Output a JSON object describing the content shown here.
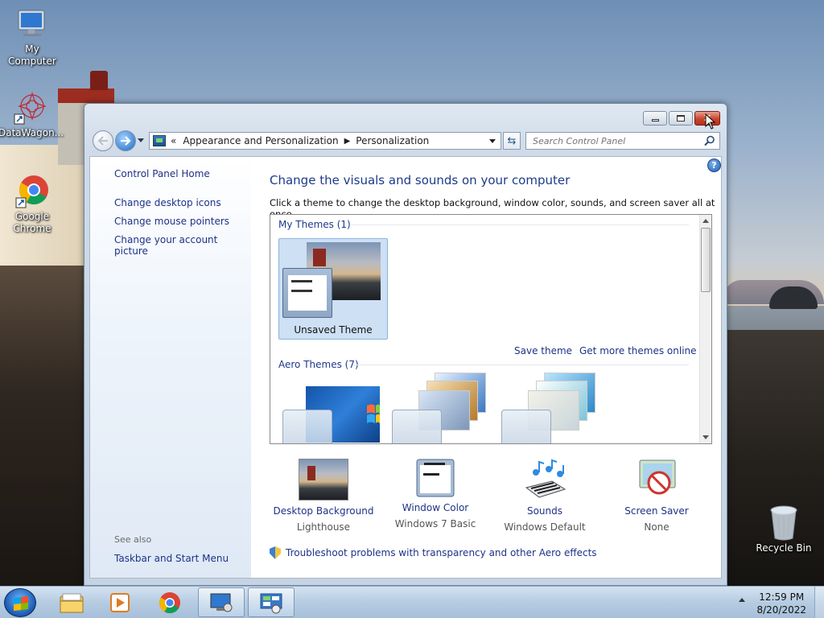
{
  "desktop": {
    "icons": [
      {
        "label": "My Computer",
        "icon": "computer-icon"
      },
      {
        "label": "DataWagon...",
        "icon": "datawagon-icon"
      },
      {
        "label": "Google Chrome",
        "icon": "chrome-icon"
      },
      {
        "label": "Recycle Bin",
        "icon": "recycle-bin-icon"
      }
    ]
  },
  "window": {
    "address": {
      "overflow": "«",
      "crumbs": [
        "Appearance and Personalization",
        "Personalization"
      ]
    },
    "search_placeholder": "Search Control Panel",
    "left_pane": {
      "links": [
        "Control Panel Home",
        "Change desktop icons",
        "Change mouse pointers",
        "Change your account picture"
      ],
      "see_also_label": "See also",
      "see_also_links": [
        "Taskbar and Start Menu"
      ]
    },
    "main": {
      "title": "Change the visuals and sounds on your computer",
      "subtitle": "Click a theme to change the desktop background, window color, sounds, and screen saver all at once.",
      "groups": [
        {
          "title": "My Themes (1)",
          "themes": [
            "Unsaved Theme"
          ]
        },
        {
          "title": "Aero Themes (7)",
          "themes": []
        }
      ],
      "save_theme": "Save theme",
      "get_more": "Get more themes online",
      "settings": [
        {
          "link": "Desktop Background",
          "value": "Lighthouse",
          "icon": "desktop-background-icon"
        },
        {
          "link": "Window Color",
          "value": "Windows 7 Basic",
          "icon": "window-color-icon"
        },
        {
          "link": "Sounds",
          "value": "Windows Default",
          "icon": "sounds-icon"
        },
        {
          "link": "Screen Saver",
          "value": "None",
          "icon": "screen-saver-icon"
        }
      ],
      "troubleshoot": "Troubleshoot problems with transparency and other Aero effects"
    }
  },
  "taskbar": {
    "apps": [
      "explorer-icon",
      "media-player-icon",
      "chrome-icon",
      "remote-desktop-icon",
      "control-panel-icon"
    ],
    "time": "12:59 PM",
    "date": "8/20/2022"
  }
}
